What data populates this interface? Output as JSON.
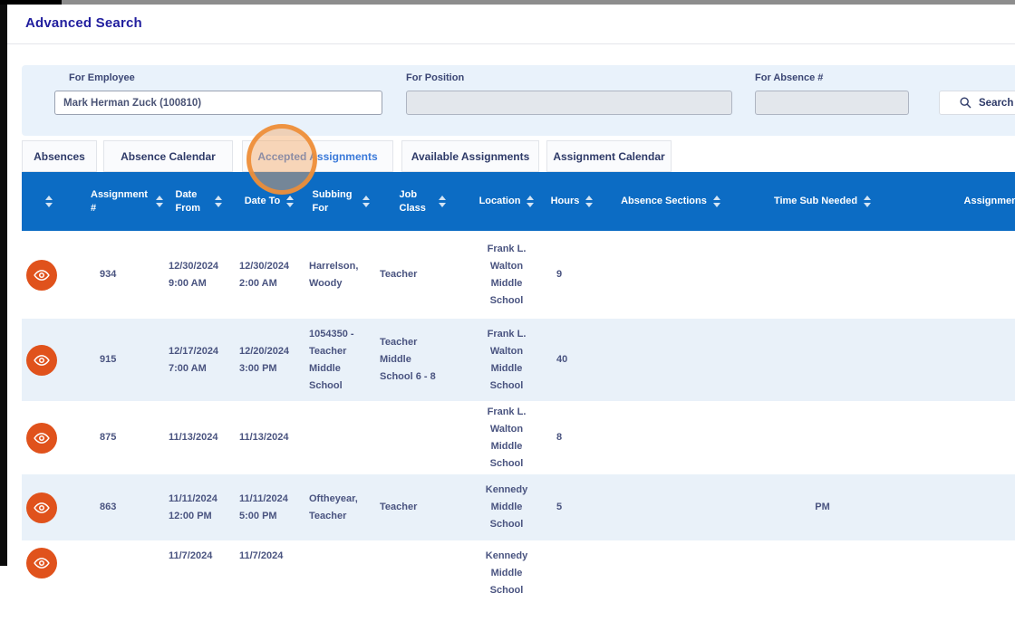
{
  "page": {
    "title": "Advanced Search"
  },
  "colors": {
    "table_header_blue": "#0c6cc4",
    "row_alt_blue": "#e9f1f9",
    "eye_icon_orange": "#e0521c",
    "click_circle_orange": "#ee8d37",
    "active_tab_blue": "#3a79d9",
    "title_navy": "#211e9e",
    "filter_panel_blue": "#e9f2fb"
  },
  "icons": {
    "search": "magnifier",
    "view": "eye",
    "sort": "up-down-triangles"
  },
  "filters": {
    "employee": {
      "label": "For Employee",
      "value": "Mark Herman Zuck (100810)"
    },
    "position": {
      "label": "For Position",
      "value": ""
    },
    "absence": {
      "label": "For Absence #",
      "value": ""
    },
    "search_button": "Search"
  },
  "tabs": [
    {
      "label": "Absences",
      "active": false
    },
    {
      "label": "Absence Calendar",
      "active": false
    },
    {
      "label": "Accepted Assignments",
      "active": true
    },
    {
      "label": "Available Assignments",
      "active": false
    },
    {
      "label": "Assignment Calendar",
      "active": false
    }
  ],
  "table": {
    "headers": [
      "",
      "Assignment #",
      "Date From",
      "Date To",
      "Subbing For",
      "Job Class",
      "Location",
      "Hours",
      "Absence Sections",
      "Time Sub Needed",
      "Assignment"
    ],
    "rows": [
      {
        "assignment": "934",
        "date_from": "12/30/2024 9:00 AM",
        "date_to": "12/30/2024 2:00 AM",
        "subbing_for": "Harrelson, Woody",
        "job_class": "Teacher",
        "location": "Frank L. Walton Middle School",
        "hours": "9",
        "absence_sections": "",
        "time_sub_needed": ""
      },
      {
        "assignment": "915",
        "date_from": "12/17/2024 7:00 AM",
        "date_to": "12/20/2024 3:00 PM",
        "subbing_for": "1054350 - Teacher Middle School",
        "job_class": "Teacher Middle School 6 - 8",
        "location": "Frank L. Walton Middle School",
        "hours": "40",
        "absence_sections": "",
        "time_sub_needed": ""
      },
      {
        "assignment": "875",
        "date_from": "11/13/2024",
        "date_to": "11/13/2024",
        "subbing_for": "",
        "job_class": "",
        "location": "Frank L. Walton Middle School",
        "hours": "8",
        "absence_sections": "",
        "time_sub_needed": ""
      },
      {
        "assignment": "863",
        "date_from": "11/11/2024 12:00 PM",
        "date_to": "11/11/2024 5:00 PM",
        "subbing_for": "Oftheyear, Teacher",
        "job_class": "Teacher",
        "location": "Kennedy Middle School",
        "hours": "5",
        "absence_sections": "",
        "time_sub_needed": "PM"
      },
      {
        "assignment": "",
        "date_from": "11/7/2024",
        "date_to": "11/7/2024",
        "subbing_for": "",
        "job_class": "",
        "location": "Kennedy Middle School",
        "hours": "",
        "absence_sections": "",
        "time_sub_needed": ""
      }
    ]
  }
}
